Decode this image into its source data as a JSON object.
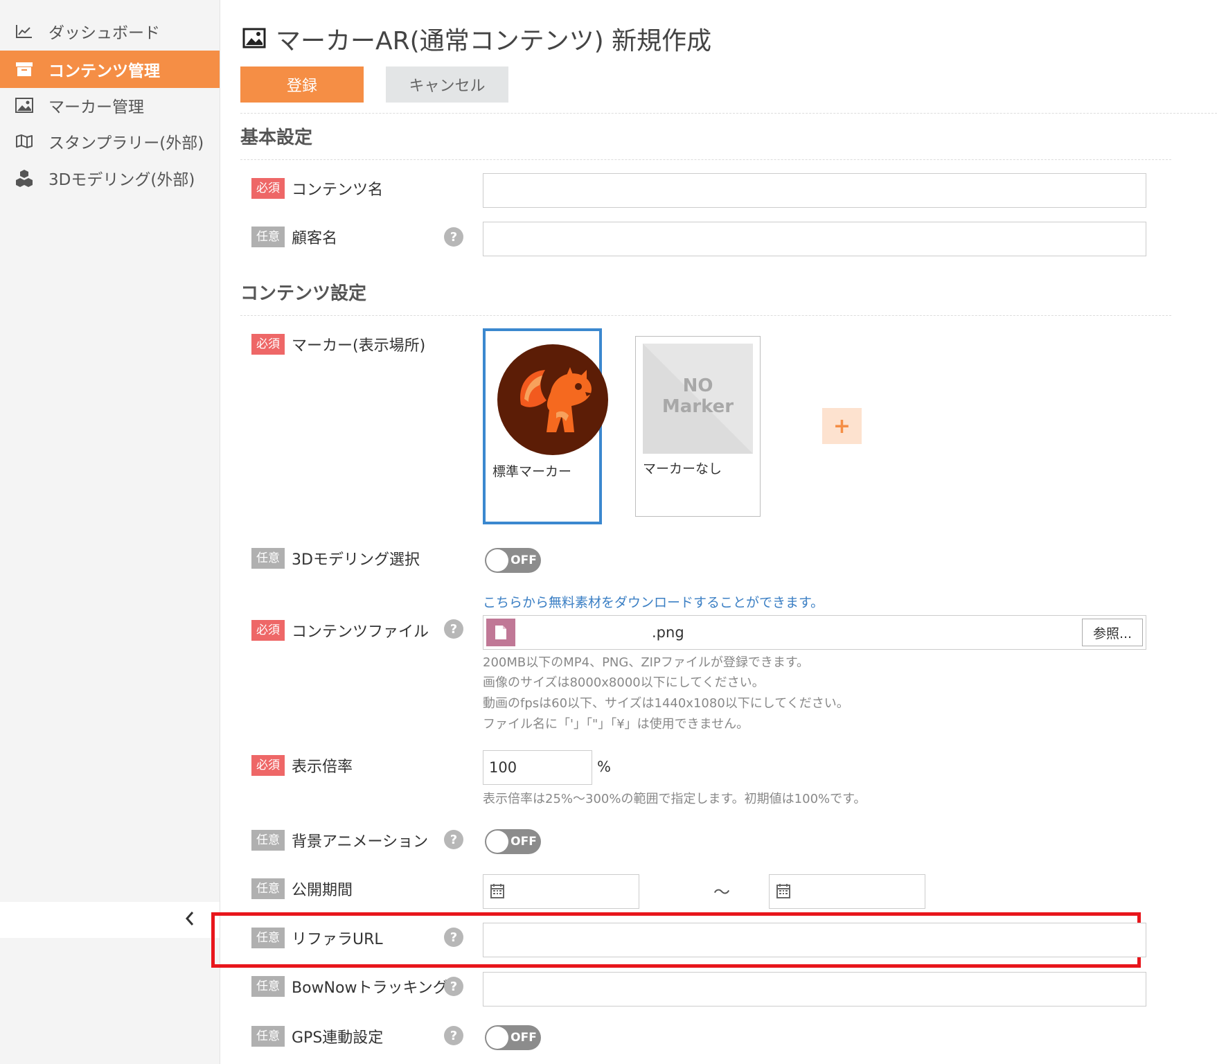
{
  "sidebar": {
    "items": [
      {
        "label": "ダッシュボード",
        "icon": "chart-line-icon"
      },
      {
        "label": "コンテンツ管理",
        "icon": "archive-box-icon",
        "active": true
      },
      {
        "label": "マーカー管理",
        "icon": "image-icon"
      },
      {
        "label": "スタンプラリー(外部)",
        "icon": "map-icon"
      },
      {
        "label": "3Dモデリング(外部)",
        "icon": "cubes-icon"
      }
    ],
    "collapse_icon": "chevron-left-icon"
  },
  "header": {
    "title": "マーカーAR(通常コンテンツ) 新規作成",
    "title_icon": "image-icon",
    "register_label": "登録",
    "cancel_label": "キャンセル"
  },
  "colors": {
    "accent": "#f58e45",
    "required": "#ee6767",
    "optional": "#b0b0b0",
    "selected": "#3b88cf",
    "highlight": "#e8161c",
    "link": "#3b7fc4"
  },
  "badges": {
    "required": "必須",
    "optional": "任意"
  },
  "basic": {
    "title": "基本設定",
    "content_name": {
      "label": "コンテンツ名",
      "value": ""
    },
    "customer_name": {
      "label": "顧客名",
      "value": ""
    }
  },
  "content": {
    "title": "コンテンツ設定",
    "marker": {
      "label": "マーカー(表示場所)",
      "options": [
        {
          "caption": "標準マーカー",
          "selected": true
        },
        {
          "caption": "マーカーなし",
          "placeholder": "NO Marker",
          "selected": false
        }
      ],
      "add_label": "+"
    },
    "modeling": {
      "label": "3Dモデリング選択",
      "toggle": "OFF"
    },
    "file": {
      "link": "こちらから無料素材をダウンロードすることができます。",
      "label": "コンテンツファイル",
      "file_name": ".png",
      "browse_label": "参照...",
      "notes": [
        "200MB以下のMP4、PNG、ZIPファイルが登録できます。",
        "画像のサイズは8000x8000以下にしてください。",
        "動画のfpsは60以下、サイズは1440x1080以下にしてください。",
        "ファイル名に「'」「\"」「¥」は使用できません。"
      ]
    },
    "scale": {
      "label": "表示倍率",
      "value": "100",
      "unit": "%",
      "note": "表示倍率は25%～300%の範囲で指定します。初期値は100%です。"
    },
    "bg_animation": {
      "label": "背景アニメーション",
      "toggle": "OFF"
    },
    "period": {
      "label": "公開期間",
      "start": "",
      "end": "",
      "separator": "～"
    },
    "referrer_url": {
      "label": "リファラURL",
      "value": ""
    },
    "bownow": {
      "label": "BowNowトラッキング",
      "value": ""
    },
    "gps": {
      "label": "GPS連動設定",
      "toggle": "OFF"
    }
  },
  "help_glyph": "?"
}
